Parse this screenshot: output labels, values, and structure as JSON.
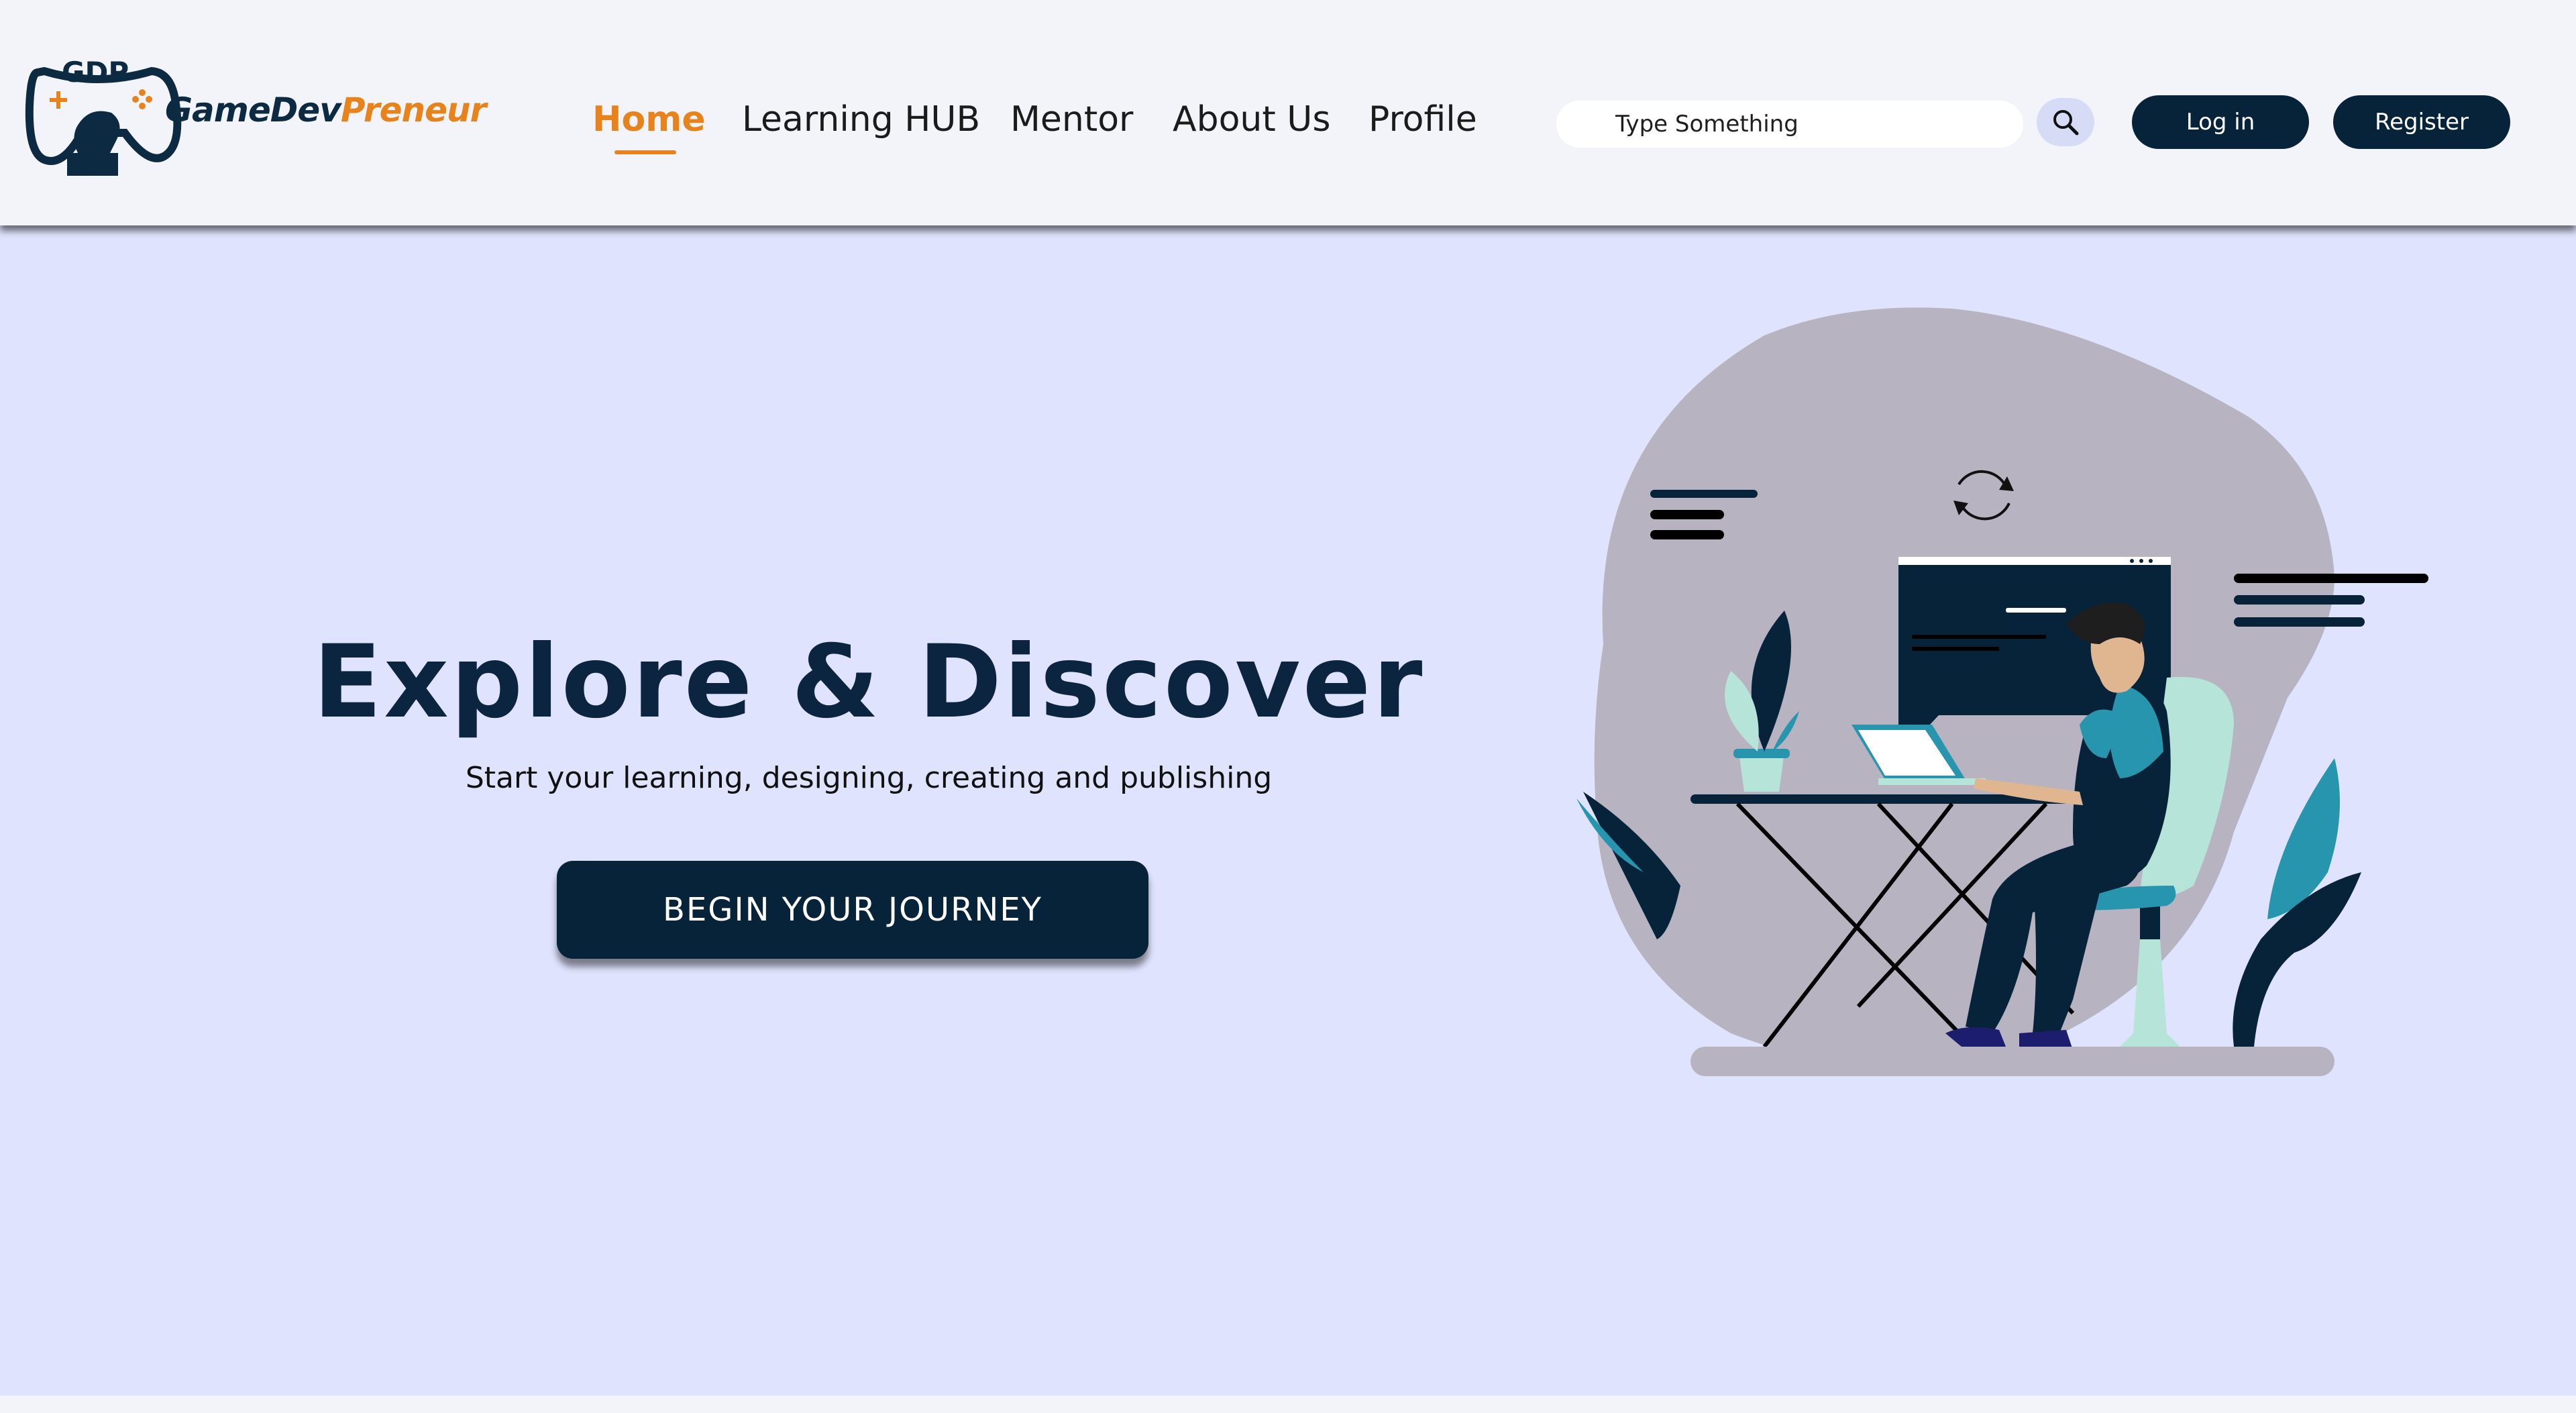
{
  "header": {
    "brand_part1": "GameDev",
    "brand_part2": "Preneur",
    "logo_letters": "GDP",
    "nav": [
      {
        "label": "Home",
        "active": true
      },
      {
        "label": "Learning HUB",
        "active": false
      },
      {
        "label": "Mentor",
        "active": false
      },
      {
        "label": "About Us",
        "active": false
      },
      {
        "label": "Profile",
        "active": false
      }
    ],
    "search_placeholder": "Type Something",
    "login_label": "Log in",
    "register_label": "Register"
  },
  "hero": {
    "title": "Explore & Discover",
    "subtitle": "Start your learning, designing, creating and publishing",
    "cta_label": "BEGIN YOUR JOURNEY"
  },
  "icons": {
    "logo": "gamepad-logo-icon",
    "search": "search-icon",
    "illustration": "person-at-laptop-illustration"
  },
  "colors": {
    "accent": "#e8831c",
    "navy": "#06233a",
    "hero_bg": "#dfe3fd",
    "header_bg": "#f3f4fa"
  }
}
